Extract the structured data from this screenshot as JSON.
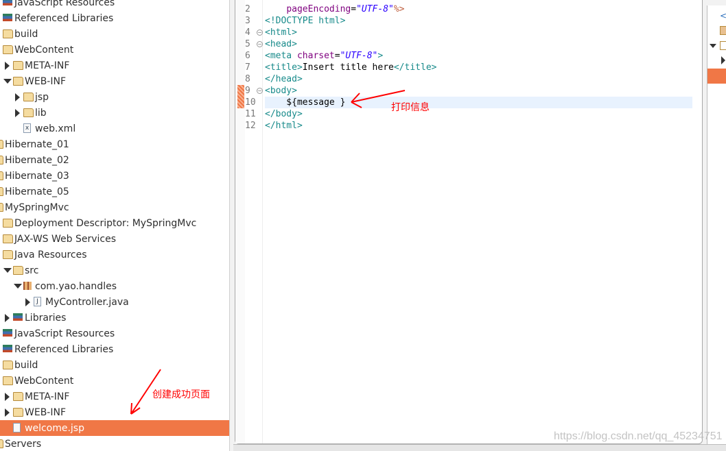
{
  "tree": [
    {
      "label": "JavaScript Resources",
      "level": 0,
      "icon": "library-icon",
      "toggle": "none"
    },
    {
      "label": "Referenced Libraries",
      "level": 0,
      "icon": "library-icon",
      "toggle": "none"
    },
    {
      "label": "build",
      "level": 0,
      "icon": "folder-icon",
      "toggle": "none"
    },
    {
      "label": "WebContent",
      "level": 0,
      "icon": "folder-icon",
      "toggle": "none"
    },
    {
      "label": "META-INF",
      "level": 1,
      "icon": "folder-icon",
      "toggle": "closed"
    },
    {
      "label": "WEB-INF",
      "level": 1,
      "icon": "folder-icon",
      "toggle": "open"
    },
    {
      "label": "jsp",
      "level": 2,
      "icon": "folder-icon",
      "toggle": "closed"
    },
    {
      "label": "lib",
      "level": 2,
      "icon": "folder-icon",
      "toggle": "closed"
    },
    {
      "label": "web.xml",
      "level": 2,
      "icon": "xml-file-icon",
      "toggle": "none"
    },
    {
      "label": "Hibernate_01",
      "level": -1,
      "icon": "project-icon",
      "toggle": "none"
    },
    {
      "label": "Hibernate_02",
      "level": -1,
      "icon": "project-icon",
      "toggle": "none"
    },
    {
      "label": "Hibernate_03",
      "level": -1,
      "icon": "project-icon",
      "toggle": "none"
    },
    {
      "label": "Hibernate_05",
      "level": -1,
      "icon": "project-icon",
      "toggle": "none"
    },
    {
      "label": "MySpringMvc",
      "level": -1,
      "icon": "project-icon",
      "toggle": "none"
    },
    {
      "label": "Deployment Descriptor: MySpringMvc",
      "level": 0,
      "icon": "deployment-descriptor-icon",
      "toggle": "none"
    },
    {
      "label": "JAX-WS Web Services",
      "level": 0,
      "icon": "web-services-icon",
      "toggle": "none"
    },
    {
      "label": "Java Resources",
      "level": 0,
      "icon": "java-resources-icon",
      "toggle": "none"
    },
    {
      "label": "src",
      "level": 1,
      "icon": "source-folder-icon",
      "toggle": "open"
    },
    {
      "label": "com.yao.handles",
      "level": 2,
      "icon": "package-icon",
      "toggle": "open"
    },
    {
      "label": "MyController.java",
      "level": 3,
      "icon": "java-file-icon",
      "toggle": "closed"
    },
    {
      "label": "Libraries",
      "level": 1,
      "icon": "library-icon",
      "toggle": "closed"
    },
    {
      "label": "JavaScript Resources",
      "level": 0,
      "icon": "library-icon",
      "toggle": "none"
    },
    {
      "label": "Referenced Libraries",
      "level": 0,
      "icon": "library-icon",
      "toggle": "none"
    },
    {
      "label": "build",
      "level": 0,
      "icon": "folder-icon",
      "toggle": "none"
    },
    {
      "label": "WebContent",
      "level": 0,
      "icon": "folder-icon",
      "toggle": "none"
    },
    {
      "label": "META-INF",
      "level": 1,
      "icon": "folder-icon",
      "toggle": "closed"
    },
    {
      "label": "WEB-INF",
      "level": 1,
      "icon": "folder-icon",
      "toggle": "closed"
    },
    {
      "label": "welcome.jsp",
      "level": 1,
      "icon": "jsp-file-icon",
      "toggle": "none",
      "selected": true
    },
    {
      "label": "Servers",
      "level": -1,
      "icon": "project-icon",
      "toggle": "none"
    }
  ],
  "editor": {
    "current_line": 10,
    "lines": [
      {
        "n": "2",
        "html": "    <span class='attr'>pageEncoding</span>=<span class='str'>\"UTF-8\"</span><span class='dir'>%&gt;</span>"
      },
      {
        "n": "3",
        "html": "<span class='tag'>&lt;!DOCTYPE html&gt;</span>"
      },
      {
        "n": "4",
        "fold": true,
        "html": "<span class='tag'>&lt;html&gt;</span>"
      },
      {
        "n": "5",
        "fold": true,
        "html": "<span class='tag'>&lt;head&gt;</span>"
      },
      {
        "n": "6",
        "html": "<span class='tag'>&lt;meta</span> <span class='attr'>charset</span>=<span class='str'>\"UTF-8\"</span><span class='tag'>&gt;</span>"
      },
      {
        "n": "7",
        "html": "<span class='tag'>&lt;title&gt;</span>Insert title here<span class='tag'>&lt;/title&gt;</span>"
      },
      {
        "n": "8",
        "html": "<span class='tag'>&lt;/head&gt;</span>"
      },
      {
        "n": "9",
        "fold": true,
        "mark": true,
        "html": "<span class='tag'>&lt;body&gt;</span>"
      },
      {
        "n": "10",
        "mark": true,
        "html": "    ${message }"
      },
      {
        "n": "11",
        "html": "<span class='tag'>&lt;/body&gt;</span>"
      },
      {
        "n": "12",
        "html": "<span class='tag'>&lt;/html&gt;</span>"
      }
    ]
  },
  "annotations": {
    "print_message": "打印信息",
    "page_created": "创建成功页面",
    "color": "#ff0000"
  },
  "watermark": "https://blog.csdn.net/qq_45234751",
  "colors": {
    "selection": "#f07746",
    "current_line": "#e8f2fe"
  }
}
